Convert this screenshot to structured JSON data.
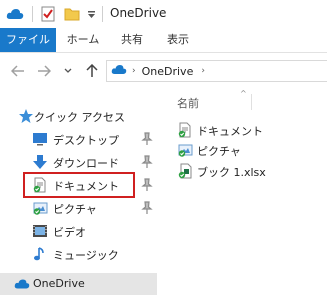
{
  "window": {
    "title": "OneDrive"
  },
  "ribbon": {
    "tabs": [
      "ファイル",
      "ホーム",
      "共有",
      "表示"
    ]
  },
  "address": {
    "crumb": "OneDrive"
  },
  "nav": {
    "quick_access": "クイック アクセス",
    "pinned": [
      {
        "label": "デスクトップ",
        "icon": "desktop-icon"
      },
      {
        "label": "ダウンロード",
        "icon": "download-icon"
      },
      {
        "label": "ドキュメント",
        "icon": "document-icon"
      },
      {
        "label": "ピクチャ",
        "icon": "picture-icon"
      }
    ],
    "others": [
      {
        "label": "ビデオ",
        "icon": "video-icon"
      },
      {
        "label": "ミュージック",
        "icon": "music-icon"
      }
    ],
    "onedrive": "OneDrive"
  },
  "content": {
    "column_header": "名前",
    "items": [
      {
        "label": "ドキュメント",
        "icon": "document-icon"
      },
      {
        "label": "ピクチャ",
        "icon": "picture-icon"
      },
      {
        "label": "ブック 1.xlsx",
        "icon": "excel-file-icon"
      }
    ]
  },
  "colors": {
    "accent": "#1979ca",
    "highlight_border": "#d02020",
    "sync_green": "#2ea043",
    "selected_row": "#e5e5e5"
  }
}
